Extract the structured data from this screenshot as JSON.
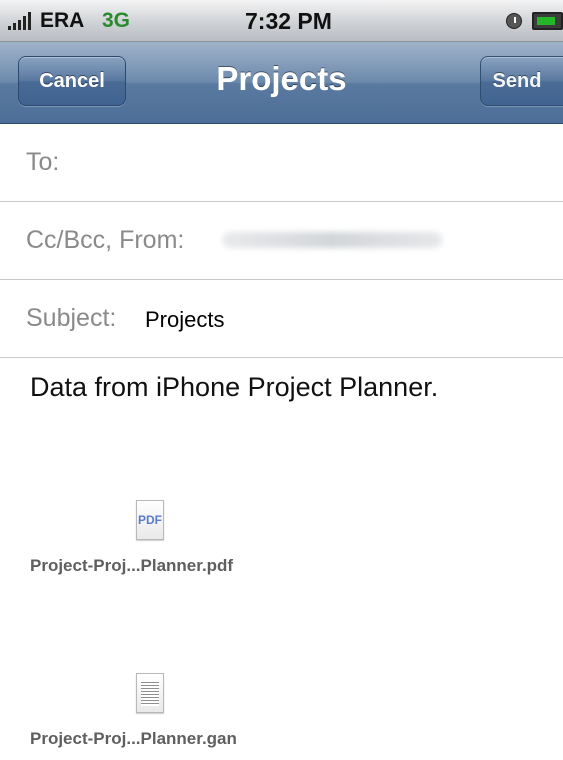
{
  "status_bar": {
    "carrier": "ERA",
    "network": "3G",
    "time": "7:32 PM"
  },
  "nav": {
    "title": "Projects",
    "cancel_label": "Cancel",
    "send_label": "Send"
  },
  "fields": {
    "to_label": "To:",
    "cc_label": "Cc/Bcc, From:",
    "subject_label": "Subject:",
    "subject_value": "Projects"
  },
  "body": {
    "text": "Data from iPhone Project Planner."
  },
  "attachments": [
    {
      "name": "Project-Proj...Planner.pdf",
      "icon_text": "PDF",
      "icon": "pdf-file-icon"
    },
    {
      "name": "Project-Proj...Planner.gan",
      "icon": "document-file-icon"
    }
  ],
  "colors": {
    "nav_bar": "#5a7aa0",
    "network": "#2a8a2e",
    "label_gray": "#8a8a8a"
  }
}
